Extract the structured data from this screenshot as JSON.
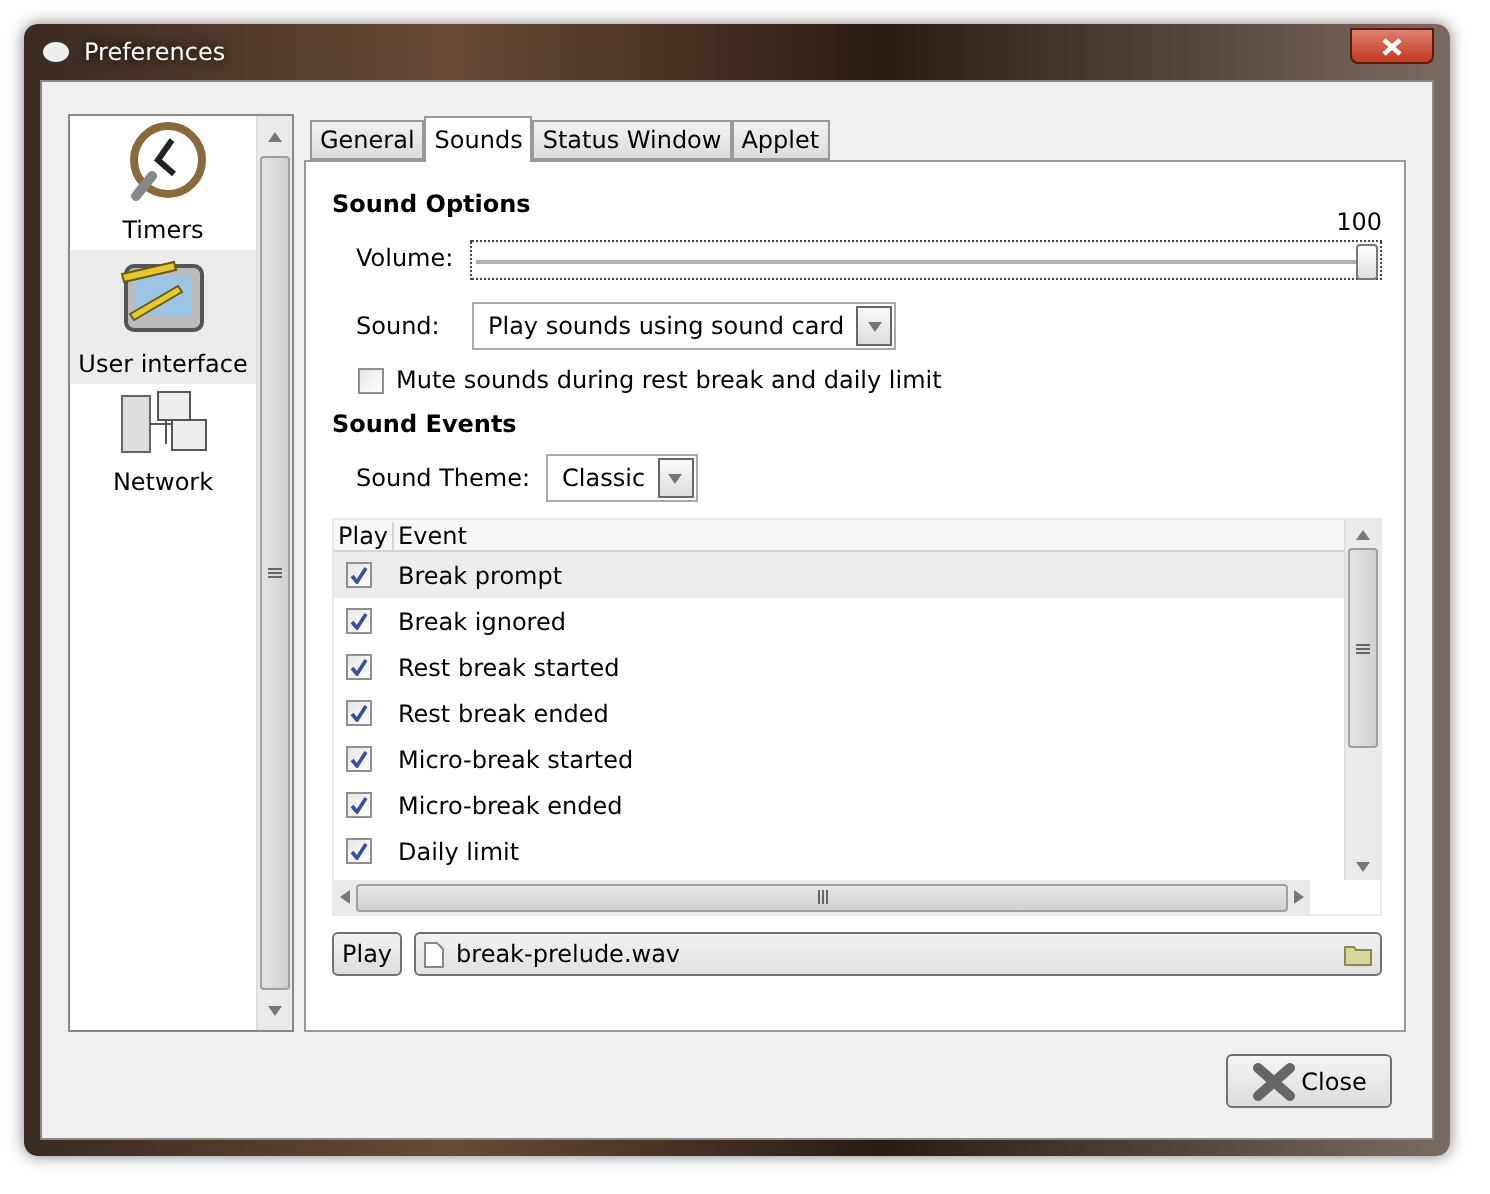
{
  "window": {
    "title": "Preferences"
  },
  "sidebar": {
    "items": [
      {
        "label": "Timers",
        "selected": false
      },
      {
        "label": "User interface",
        "selected": true
      },
      {
        "label": "Network",
        "selected": false
      }
    ]
  },
  "tabs": [
    {
      "label": "General",
      "selected": false
    },
    {
      "label": "Sounds",
      "selected": true
    },
    {
      "label": "Status Window",
      "selected": false
    },
    {
      "label": "Applet",
      "selected": false
    }
  ],
  "sound_options": {
    "heading": "Sound Options",
    "volume_label": "Volume:",
    "volume_reading": "100",
    "volume": {
      "level": 1
    },
    "sound_label": "Sound:",
    "sound_value": "Play sounds using sound card",
    "mute": {
      "label": "Mute sounds during rest break and daily limit",
      "checked": false
    }
  },
  "sound_events": {
    "heading": "Sound Events",
    "theme_label": "Sound Theme:",
    "theme_value": "Classic",
    "columns": [
      "Play",
      "Event"
    ],
    "rows": [
      {
        "event": "Break prompt",
        "checked": true,
        "selected": true
      },
      {
        "event": "Break ignored",
        "checked": true,
        "selected": false
      },
      {
        "event": "Rest break started",
        "checked": true,
        "selected": false
      },
      {
        "event": "Rest break ended",
        "checked": true,
        "selected": false
      },
      {
        "event": "Micro-break started",
        "checked": true,
        "selected": false
      },
      {
        "event": "Micro-break ended",
        "checked": true,
        "selected": false
      },
      {
        "event": "Daily limit",
        "checked": true,
        "selected": false
      }
    ],
    "play_button": "Play",
    "file": "break-prelude.wav"
  },
  "buttons": {
    "close": "Close"
  }
}
